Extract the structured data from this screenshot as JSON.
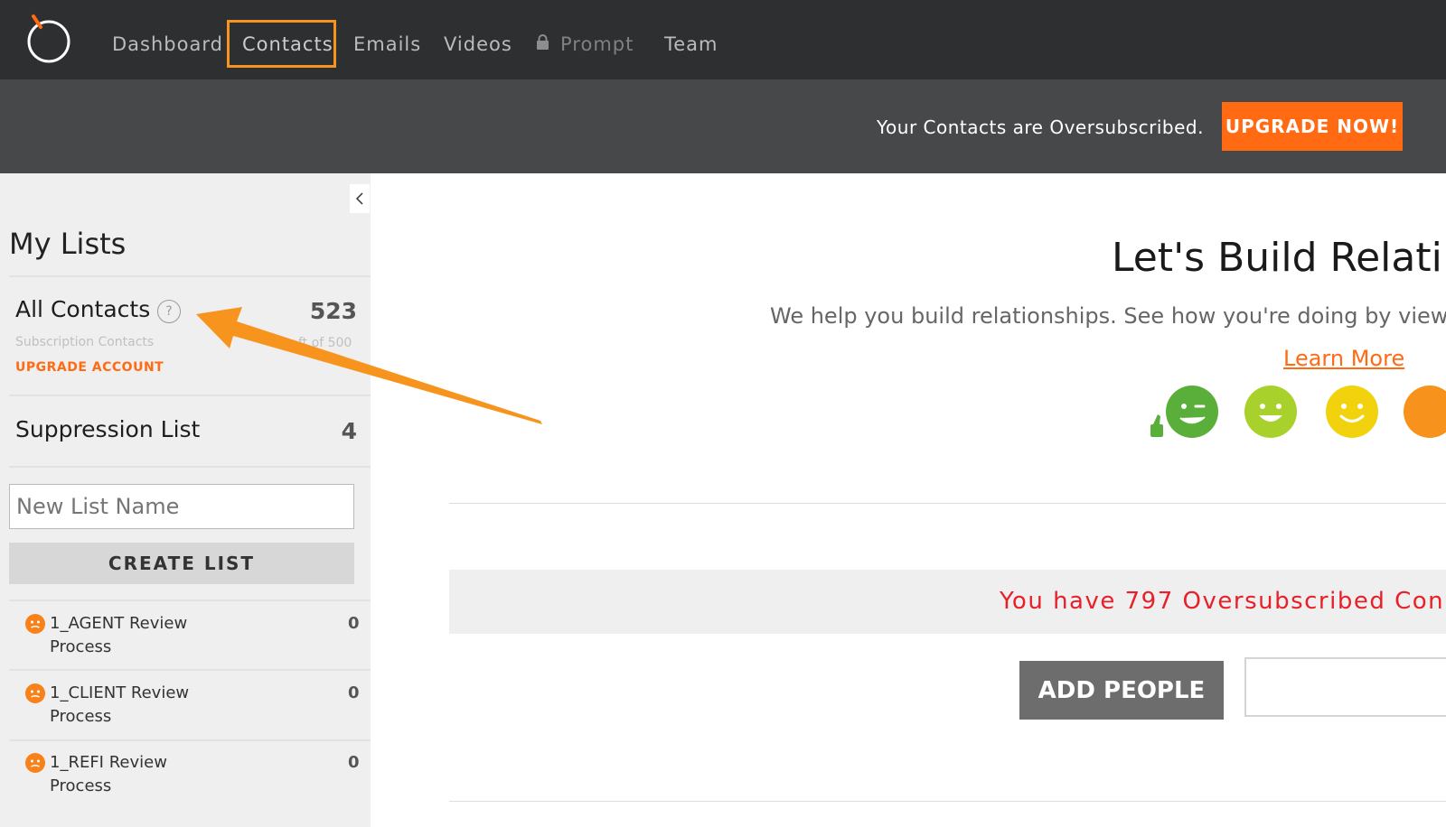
{
  "nav": {
    "items": [
      {
        "label": "Dashboard"
      },
      {
        "label": "Contacts"
      },
      {
        "label": "Emails"
      },
      {
        "label": "Videos"
      },
      {
        "label": "Prompt",
        "icon": "lock-icon"
      },
      {
        "label": "Team"
      }
    ],
    "active": "Contacts",
    "highlight_color": "#f7941d"
  },
  "banner": {
    "message": "Your Contacts are Oversubscribed.",
    "button_label": "UPGRADE NOW!"
  },
  "sidebar": {
    "title": "My Lists",
    "all_contacts": {
      "label": "All Contacts",
      "help": "?",
      "count": "523",
      "subscription_label": "Subscription Contacts",
      "subscription_of": "ft of 500",
      "upgrade_label": "UPGRADE ACCOUNT"
    },
    "suppression": {
      "label": "Suppression List",
      "count": "4"
    },
    "new_list_placeholder": "New List Name",
    "create_button": "CREATE LIST",
    "lists": [
      {
        "line1": "1_AGENT Review",
        "line2": "Process",
        "count": "0"
      },
      {
        "line1": "1_CLIENT Review",
        "line2": "Process",
        "count": "0"
      },
      {
        "line1": "1_REFI Review",
        "line2": "Process",
        "count": "0"
      }
    ]
  },
  "main": {
    "title": "Let's Build Relati",
    "subtitle": "We help you build relationships. See how you're doing by viewing",
    "learn_more": "Learn More",
    "oversubscribed": "You have 797 Oversubscribed Con",
    "add_people": "ADD PEOPLE"
  },
  "colors": {
    "accent_orange": "#ff6a13",
    "nav_bg": "#2e2f31",
    "banner_bg": "#474849",
    "alert_red": "#e8202a"
  }
}
